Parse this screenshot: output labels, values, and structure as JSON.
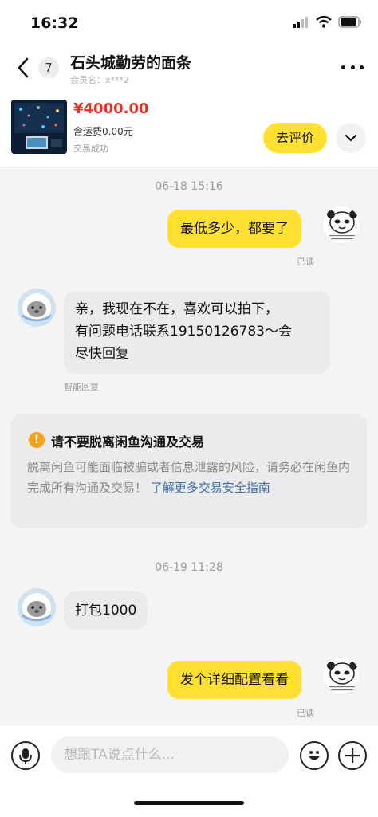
{
  "status_bar": {
    "time": "16:32",
    "icons": [
      "signal-icon",
      "wifi-icon",
      "battery-icon"
    ]
  },
  "header": {
    "unread_count": "7",
    "title": "石头城勤劳的面条",
    "member_label": "会员名：x***2"
  },
  "product": {
    "price": "¥4000.00",
    "shipping": "含运费0.00元",
    "status": "交易成功",
    "review_button": "去评价"
  },
  "messages": [
    {
      "timestamp": "06-18 15:16"
    },
    {
      "sender": "me",
      "text": "最低多少，都要了",
      "read": "已读"
    },
    {
      "sender": "seller",
      "lines": [
        "亲，我现在不在，喜欢可以拍下，",
        "有问题电话联系19150126783～会",
        "尽快回复"
      ],
      "note": "智能回复"
    },
    {
      "timestamp": "06-19 11:28"
    },
    {
      "sender": "seller",
      "text": "打包1000"
    },
    {
      "sender": "me",
      "text": "发个详细配置看看",
      "read": "已读"
    }
  ],
  "safety": {
    "title": "请不要脱离闲鱼沟通及交易",
    "body": "脱离闲鱼可能面临被骗或者信息泄露的风险，请务必在闲鱼内完成所有沟通及交易！",
    "link": "了解更多交易安全指南"
  },
  "input": {
    "placeholder": "想跟TA说点什么..."
  },
  "colors": {
    "accent_yellow": "#ffe033",
    "price_red": "#e8332a",
    "warning_orange": "#f6a21e",
    "link_blue": "#3a6ea5"
  }
}
